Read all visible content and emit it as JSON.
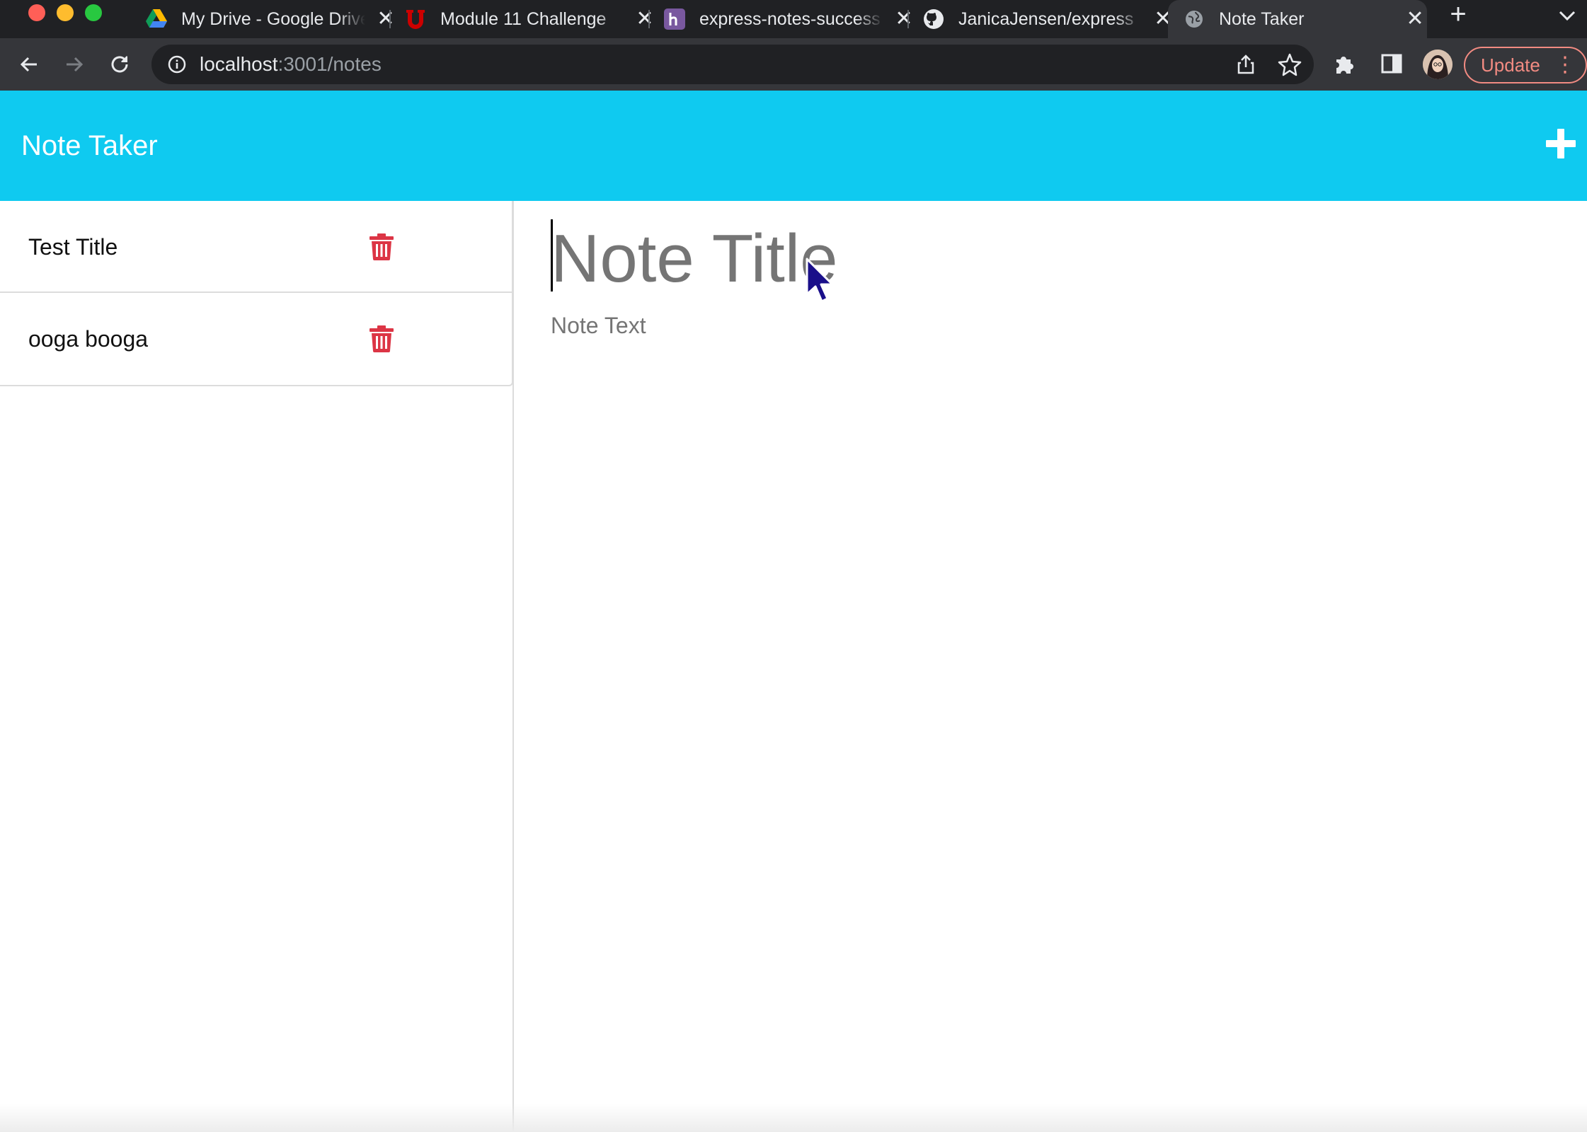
{
  "browser": {
    "tabs": [
      {
        "title": "My Drive - Google Drive",
        "icon": "google-drive-icon"
      },
      {
        "title": "Module 11 Challenge",
        "icon": "utah-u-icon"
      },
      {
        "title": "express-notes-success",
        "icon": "heroku-icon"
      },
      {
        "title": "JanicaJensen/express",
        "icon": "github-icon"
      },
      {
        "title": "Note Taker",
        "icon": "globe-icon",
        "active": true
      }
    ],
    "new_tab_label": "+",
    "close_glyph": "✕",
    "url_host": "localhost",
    "url_path": ":3001/notes",
    "update_label": "Update",
    "menu_glyph": "⋮"
  },
  "app": {
    "brand": "Note Taker",
    "accent_color": "#0fcaf0",
    "delete_color": "#dc3545",
    "notes": [
      {
        "title": "Test Title"
      },
      {
        "title": "ooga booga"
      }
    ],
    "editor": {
      "title_placeholder": "Note Title",
      "text_placeholder": "Note Text"
    }
  }
}
